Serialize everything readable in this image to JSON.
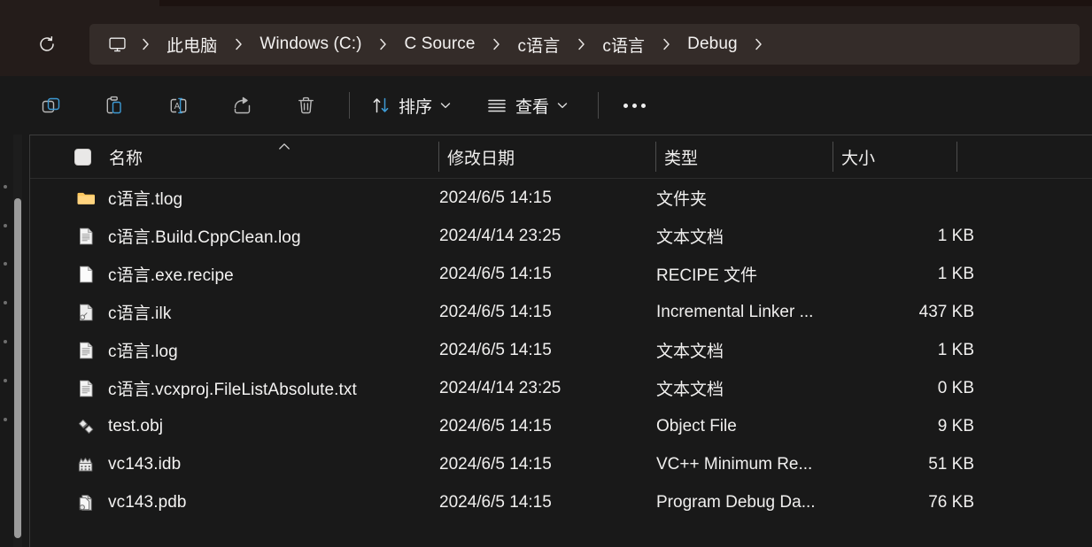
{
  "window": {
    "app": "File Explorer",
    "theme_background": "#191919",
    "navbar_background": "#241c1a",
    "addressbar_background": "#342c29",
    "accent_color": "#4fa3d1"
  },
  "navigation": {
    "refresh_tooltip": "刷新",
    "breadcrumb_root_icon": "monitor-icon",
    "breadcrumbs": [
      {
        "label": "此电脑"
      },
      {
        "label": "Windows (C:)"
      },
      {
        "label": "C Source"
      },
      {
        "label": "c语言"
      },
      {
        "label": "c语言"
      },
      {
        "label": "Debug"
      }
    ]
  },
  "toolbar": {
    "icon_buttons": [
      {
        "name": "copy-button",
        "icon": "copy-icon"
      },
      {
        "name": "paste-button",
        "icon": "paste-icon"
      },
      {
        "name": "rename-button",
        "icon": "rename-icon"
      },
      {
        "name": "share-button",
        "icon": "share-icon"
      },
      {
        "name": "delete-button",
        "icon": "trash-icon"
      }
    ],
    "sort_label": "排序",
    "view_label": "查看",
    "more_label": "..."
  },
  "columns": [
    {
      "key": "name",
      "label": "名称",
      "sort": "ascending"
    },
    {
      "key": "date",
      "label": "修改日期"
    },
    {
      "key": "type",
      "label": "类型"
    },
    {
      "key": "size",
      "label": "大小"
    }
  ],
  "files": [
    {
      "name": "c语言.tlog",
      "date": "2024/6/5 14:15",
      "type": "文件夹",
      "size": "",
      "icon": "folder-icon"
    },
    {
      "name": "c语言.Build.CppClean.log",
      "date": "2024/4/14 23:25",
      "type": "文本文档",
      "size": "1 KB",
      "icon": "text-document-icon"
    },
    {
      "name": "c语言.exe.recipe",
      "date": "2024/6/5 14:15",
      "type": "RECIPE 文件",
      "size": "1 KB",
      "icon": "blank-document-icon"
    },
    {
      "name": "c语言.ilk",
      "date": "2024/6/5 14:15",
      "type": "Incremental Linker ...",
      "size": "437 KB",
      "icon": "linker-file-icon"
    },
    {
      "name": "c语言.log",
      "date": "2024/6/5 14:15",
      "type": "文本文档",
      "size": "1 KB",
      "icon": "text-document-icon"
    },
    {
      "name": "c语言.vcxproj.FileListAbsolute.txt",
      "date": "2024/4/14 23:25",
      "type": "文本文档",
      "size": "0 KB",
      "icon": "text-document-icon"
    },
    {
      "name": "test.obj",
      "date": "2024/6/5 14:15",
      "type": "Object File",
      "size": "9 KB",
      "icon": "object-file-icon"
    },
    {
      "name": "vc143.idb",
      "date": "2024/6/5 14:15",
      "type": "VC++ Minimum Re...",
      "size": "51 KB",
      "icon": "idb-file-icon"
    },
    {
      "name": "vc143.pdb",
      "date": "2024/6/5 14:15",
      "type": "Program Debug Da...",
      "size": "76 KB",
      "icon": "pdb-file-icon"
    }
  ]
}
